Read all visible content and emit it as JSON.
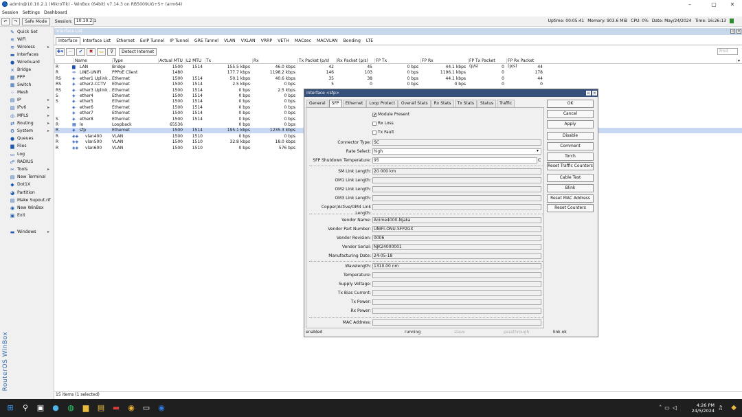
{
  "window": {
    "title": "admin@10.10.2.1 (MikroTik) - WinBox (64bit) v7.14.3 on RB5009UG+S+ (arm64)"
  },
  "menu": [
    "Session",
    "Settings",
    "Dashboard"
  ],
  "toolbar": {
    "safe_mode": "Safe Mode",
    "session_label": "Session:",
    "session_value": "10.10.2.1",
    "uptime": "Uptime: 00:05:41",
    "memory": "Memory: 903.6 MiB",
    "cpu": "CPU: 0%",
    "date": "Date: May/24/2024",
    "time": "Time: 16:26:13"
  },
  "sidebar": [
    {
      "label": "Quick Set",
      "icon": "quick-set-icon",
      "glyph": "✎"
    },
    {
      "label": "WiFi",
      "icon": "wifi-icon",
      "glyph": "≋"
    },
    {
      "label": "Wireless",
      "icon": "wireless-icon",
      "glyph": "≋",
      "arrow": true
    },
    {
      "label": "Interfaces",
      "icon": "interfaces-icon",
      "glyph": "▬"
    },
    {
      "label": "WireGuard",
      "icon": "wireguard-icon",
      "glyph": "●"
    },
    {
      "label": "Bridge",
      "icon": "bridge-icon",
      "glyph": "⨯"
    },
    {
      "label": "PPP",
      "icon": "ppp-icon",
      "glyph": "▦"
    },
    {
      "label": "Switch",
      "icon": "switch-icon",
      "glyph": "▦"
    },
    {
      "label": "Mesh",
      "icon": "mesh-icon",
      "glyph": "⁘"
    },
    {
      "label": "IP",
      "icon": "ip-icon",
      "glyph": "▤",
      "arrow": true
    },
    {
      "label": "IPv6",
      "icon": "ipv6-icon",
      "glyph": "▤",
      "arrow": true
    },
    {
      "label": "MPLS",
      "icon": "mpls-icon",
      "glyph": "◎",
      "arrow": true
    },
    {
      "label": "Routing",
      "icon": "routing-icon",
      "glyph": "⇄",
      "arrow": true
    },
    {
      "label": "System",
      "icon": "system-icon",
      "glyph": "⚙",
      "arrow": true
    },
    {
      "label": "Queues",
      "icon": "queues-icon",
      "glyph": "●"
    },
    {
      "label": "Files",
      "icon": "files-icon",
      "glyph": "▆"
    },
    {
      "label": "Log",
      "icon": "log-icon",
      "glyph": "▭"
    },
    {
      "label": "RADIUS",
      "icon": "radius-icon",
      "glyph": "☍"
    },
    {
      "label": "Tools",
      "icon": "tools-icon",
      "glyph": "✂",
      "arrow": true
    },
    {
      "label": "New Terminal",
      "icon": "terminal-icon",
      "glyph": "▤"
    },
    {
      "label": "Dot1X",
      "icon": "dot1x-icon",
      "glyph": "◆"
    },
    {
      "label": "Partition",
      "icon": "partition-icon",
      "glyph": "◕"
    },
    {
      "label": "Make Supout.rif",
      "icon": "supout-icon",
      "glyph": "▤"
    },
    {
      "label": "New WinBox",
      "icon": "winbox-icon",
      "glyph": "◉"
    },
    {
      "label": "Exit",
      "icon": "exit-icon",
      "glyph": "▣"
    },
    {
      "label": "Windows",
      "icon": "windows-icon",
      "glyph": "▬",
      "arrow": true
    }
  ],
  "brand_vertical": "RouterOS WinBox",
  "interface_list": {
    "title": "Interface List",
    "tabs": [
      "Interface",
      "Interface List",
      "Ethernet",
      "EoIP Tunnel",
      "IP Tunnel",
      "GRE Tunnel",
      "VLAN",
      "VXLAN",
      "VRRP",
      "VETH",
      "MACsec",
      "MACVLAN",
      "Bonding",
      "LTE"
    ],
    "detect_internet": "Detect Internet",
    "find_placeholder": "Find",
    "columns": [
      "Name",
      "Type",
      "Actual MTU",
      "L2 MTU",
      "Tx",
      "Rx",
      "Tx Packet (p/s)",
      "Rx Packet (p/s)",
      "FP Tx",
      "FP Rx",
      "FP Tx Packet (p/s)",
      "FP Rx Packet (p/s)"
    ],
    "rows": [
      {
        "flags": "R",
        "name": "LAN",
        "icon": "▆",
        "type": "Bridge",
        "mtu": "1500",
        "l2mtu": "1514",
        "tx": "155.5 kbps",
        "rx": "46.0 kbps",
        "txp": "42",
        "rxp": "45",
        "fptx": "0 bps",
        "fprx": "44.1 kbps",
        "fptxp": "0",
        "fprxp": "44"
      },
      {
        "flags": "R",
        "name": "LINE-UNIFI",
        "icon": "⇔",
        "type": "PPPoE Client",
        "mtu": "1480",
        "l2mtu": "",
        "tx": "177.7 kbps",
        "rx": "1198.2 kbps",
        "txp": "146",
        "rxp": "103",
        "fptx": "0 bps",
        "fprx": "1196.1 kbps",
        "fptxp": "0",
        "fprxp": "178"
      },
      {
        "flags": "RS",
        "name": "ether1 Uplink ...",
        "icon": "◈",
        "type": "Ethernet",
        "mtu": "1500",
        "l2mtu": "1514",
        "tx": "50.1 kbps",
        "rx": "40.6 kbps",
        "txp": "35",
        "rxp": "38",
        "fptx": "0 bps",
        "fprx": "44.1 kbps",
        "fptxp": "0",
        "fprxp": "44"
      },
      {
        "flags": "RS",
        "name": "ether2-CCTV",
        "icon": "◈",
        "type": "Ethernet",
        "mtu": "1500",
        "l2mtu": "1514",
        "tx": "2.5 kbps",
        "rx": "0 bps",
        "txp": "5",
        "rxp": "0",
        "fptx": "0 bps",
        "fprx": "0 bps",
        "fptxp": "0",
        "fprxp": "0"
      },
      {
        "flags": "RS",
        "name": "ether3 Uplink ...",
        "icon": "◈",
        "type": "Ethernet",
        "mtu": "1500",
        "l2mtu": "1514",
        "tx": "0 bps",
        "rx": "2.5 kbps",
        "txp": "",
        "rxp": "",
        "fptx": "",
        "fprx": "",
        "fptxp": "",
        "fprxp": ""
      },
      {
        "flags": "S",
        "name": "ether4",
        "icon": "◈",
        "type": "Ethernet",
        "mtu": "1500",
        "l2mtu": "1514",
        "tx": "0 bps",
        "rx": "0 bps",
        "txp": "",
        "rxp": "",
        "fptx": "",
        "fprx": "",
        "fptxp": "",
        "fprxp": ""
      },
      {
        "flags": "S",
        "name": "ether5",
        "icon": "◈",
        "type": "Ethernet",
        "mtu": "1500",
        "l2mtu": "1514",
        "tx": "0 bps",
        "rx": "0 bps",
        "txp": "",
        "rxp": "",
        "fptx": "",
        "fprx": "",
        "fptxp": "",
        "fprxp": ""
      },
      {
        "flags": "",
        "name": "ether6",
        "icon": "◈",
        "type": "Ethernet",
        "mtu": "1500",
        "l2mtu": "1514",
        "tx": "0 bps",
        "rx": "0 bps",
        "txp": "",
        "rxp": "",
        "fptx": "",
        "fprx": "",
        "fptxp": "",
        "fprxp": ""
      },
      {
        "flags": "",
        "name": "ether7",
        "icon": "◈",
        "type": "Ethernet",
        "mtu": "1500",
        "l2mtu": "1514",
        "tx": "0 bps",
        "rx": "0 bps",
        "txp": "",
        "rxp": "",
        "fptx": "",
        "fprx": "",
        "fptxp": "",
        "fprxp": ""
      },
      {
        "flags": "S",
        "name": "ether8",
        "icon": "◈",
        "type": "Ethernet",
        "mtu": "1500",
        "l2mtu": "1514",
        "tx": "0 bps",
        "rx": "0 bps",
        "txp": "",
        "rxp": "",
        "fptx": "",
        "fprx": "",
        "fptxp": "",
        "fprxp": ""
      },
      {
        "flags": "R",
        "name": "lo",
        "icon": "▦",
        "type": "Loopback",
        "mtu": "65536",
        "l2mtu": "",
        "tx": "0 bps",
        "rx": "0 bps",
        "txp": "",
        "rxp": "",
        "fptx": "",
        "fprx": "",
        "fptxp": "",
        "fprxp": ""
      },
      {
        "flags": "R",
        "name": "sfp",
        "icon": "◈",
        "type": "Ethernet",
        "mtu": "1500",
        "l2mtu": "1514",
        "tx": "195.1 kbps",
        "rx": "1235.3 kbps",
        "txp": "",
        "rxp": "",
        "fptx": "",
        "fprx": "",
        "fptxp": "",
        "fprxp": "",
        "selected": true
      },
      {
        "flags": "R",
        "name": "vlan400",
        "icon": "◈◈",
        "type": "VLAN",
        "mtu": "1500",
        "l2mtu": "1510",
        "tx": "0 bps",
        "rx": "0 bps",
        "txp": "",
        "rxp": "",
        "fptx": "",
        "fprx": "",
        "fptxp": "",
        "fprxp": ""
      },
      {
        "flags": "R",
        "name": "vlan500",
        "icon": "◈◈",
        "type": "VLAN",
        "mtu": "1500",
        "l2mtu": "1510",
        "tx": "32.8 kbps",
        "rx": "18.0 kbps",
        "txp": "",
        "rxp": "",
        "fptx": "",
        "fprx": "",
        "fptxp": "",
        "fprxp": ""
      },
      {
        "flags": "R",
        "name": "vlan600",
        "icon": "◈◈",
        "type": "VLAN",
        "mtu": "1500",
        "l2mtu": "1510",
        "tx": "0 bps",
        "rx": "576 bps",
        "txp": "",
        "rxp": "",
        "fptx": "",
        "fprx": "",
        "fptxp": "",
        "fprxp": ""
      }
    ],
    "status": "15 items (1 selected)"
  },
  "dialog": {
    "title": "Interface <sfp>",
    "tabs": [
      "General",
      "SFP",
      "Ethernet",
      "Loop Protect",
      "Overall Stats",
      "Rx Stats",
      "Tx Stats",
      "Status",
      "Traffic"
    ],
    "active_tab": "SFP",
    "checkboxes": [
      {
        "label": "Module Present",
        "checked": true
      },
      {
        "label": "Rx Loss",
        "checked": false
      },
      {
        "label": "Tx Fault",
        "checked": false
      }
    ],
    "fields_top": [
      {
        "label": "Connector Type:",
        "value": "SC",
        "ro": true
      },
      {
        "label": "Rate Select:",
        "value": "high",
        "ro": false,
        "dropdown": true
      },
      {
        "label": "SFP Shutdown Temperature:",
        "value": "95",
        "ro": false,
        "unit": "C"
      }
    ],
    "fields_link": [
      {
        "label": "SM Link Length:",
        "value": "20 000 km"
      },
      {
        "label": "OM1 Link Length:",
        "value": ""
      },
      {
        "label": "OM2 Link Length:",
        "value": ""
      },
      {
        "label": "OM3 Link Length:",
        "value": ""
      },
      {
        "label": "Copper/Active/OM4 Link Length:",
        "value": ""
      }
    ],
    "fields_vendor": [
      {
        "label": "Vendor Name:",
        "value": "Anime4000-Njaka"
      },
      {
        "label": "Vendor Part Number:",
        "value": "UNIFI-ONU-SFP2GX"
      },
      {
        "label": "Vendor Revision:",
        "value": "0006"
      },
      {
        "label": "Vendor Serial:",
        "value": "NJK24000001"
      },
      {
        "label": "Manufacturing Date:",
        "value": "24-05-18"
      }
    ],
    "fields_diag": [
      {
        "label": "Wavelength:",
        "value": "1310.00 nm"
      },
      {
        "label": "Temperature:",
        "value": ""
      },
      {
        "label": "Supply Voltage:",
        "value": ""
      },
      {
        "label": "Tx Bias Current:",
        "value": ""
      },
      {
        "label": "Tx Power:",
        "value": ""
      },
      {
        "label": "Rx Power:",
        "value": ""
      }
    ],
    "fields_mac": [
      {
        "label": "MAC Address:",
        "value": ""
      }
    ],
    "buttons": [
      "OK",
      "Cancel",
      "Apply",
      "Disable",
      "Comment",
      "Torch",
      "Reset Traffic Counters",
      "Cable Test",
      "Blink",
      "Reset MAC Address",
      "Reset Counters"
    ],
    "status": {
      "s1": "enabled",
      "s2": "running",
      "s3": "slave",
      "s4": "passthrough",
      "s5": "link ok"
    }
  },
  "taskbar": {
    "time": "4:26 PM",
    "date": "24/5/2024"
  }
}
